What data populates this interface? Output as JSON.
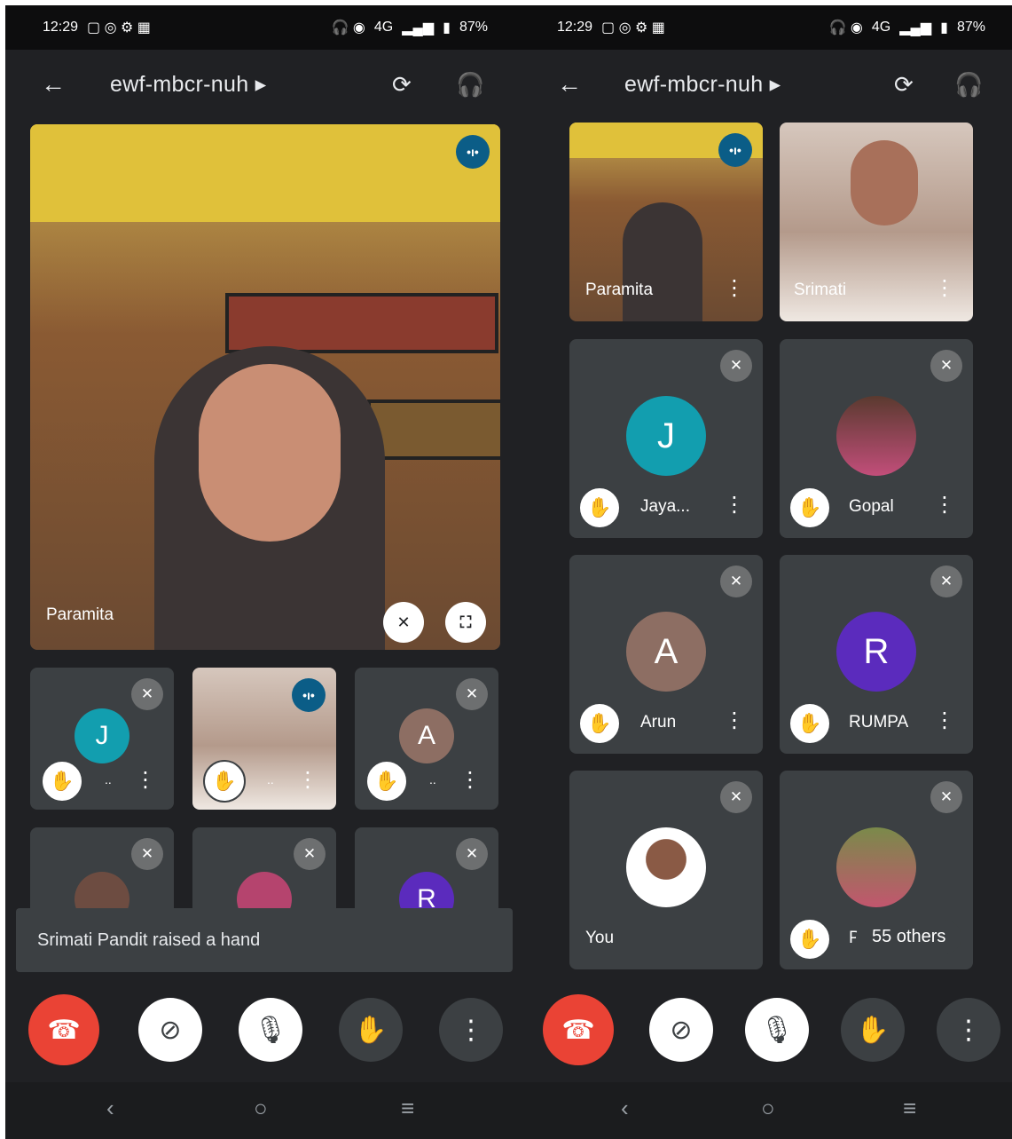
{
  "status": {
    "time": "12:29",
    "network": "4G",
    "battery": "87%"
  },
  "meeting": {
    "code": "ewf-mbcr-nuh"
  },
  "left": {
    "main_name": "Paramita",
    "small_tiles": [
      {
        "initial": "J",
        "name": "..",
        "color": "#129eaf"
      },
      {
        "name": ".."
      },
      {
        "initial": "A",
        "name": "..",
        "color": "#8d6e63"
      },
      {
        "initial": "R",
        "color": "#5b2bbd"
      }
    ],
    "toast": "Srimati Pandit raised a hand"
  },
  "right": {
    "tiles": [
      {
        "name": "Paramita"
      },
      {
        "name": "Srimati"
      },
      {
        "initial": "J",
        "name": "Jaya...",
        "color": "#129eaf"
      },
      {
        "name": "Gopal"
      },
      {
        "initial": "A",
        "name": "Arun",
        "color": "#8d6e63"
      },
      {
        "initial": "R",
        "name": "RUMPA",
        "color": "#5b2bbd"
      },
      {
        "name": "You"
      },
      {
        "name": "Pu"
      }
    ],
    "others": "55 others"
  },
  "icons": {
    "back": "arrow-left-icon",
    "camera_switch": "switch-camera-icon",
    "audio": "headphones-icon",
    "end_call": "phone-hangup-icon",
    "video_off": "video-off-icon",
    "mic_off": "mic-off-icon",
    "hand": "hand-raise-icon",
    "more": "more-vert-icon",
    "pin_off": "unpin-icon",
    "fullscreen": "fullscreen-icon"
  }
}
